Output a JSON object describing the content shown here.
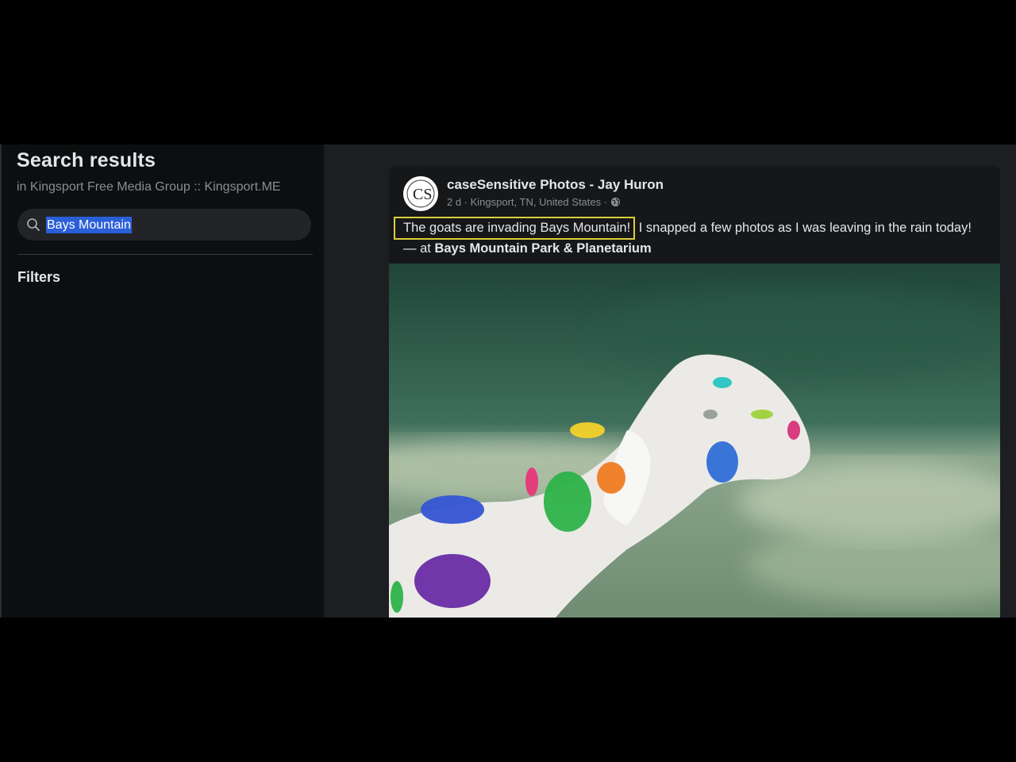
{
  "sidebar": {
    "title": "Search results",
    "subtitle": "in Kingsport Free Media Group :: Kingsport.ME",
    "search_value": "Bays Mountain",
    "filters_label": "Filters"
  },
  "post": {
    "avatar_text": "CS",
    "author": "caseSensitive Photos - Jay Huron",
    "meta": "2 d · Kingsport, TN, United States ·",
    "text_highlighted": "The goats are invading Bays Mountain!",
    "text_rest": " I snapped a few photos as I was leaving in the rain today!",
    "location_prefix": "— at ",
    "location": "Bays Mountain Park & Planetarium"
  },
  "colors": {
    "highlight_border": "#d9cf3a",
    "selection": "#2b5fd8"
  },
  "icons": {
    "search": "search-icon",
    "globe": "globe-icon"
  }
}
